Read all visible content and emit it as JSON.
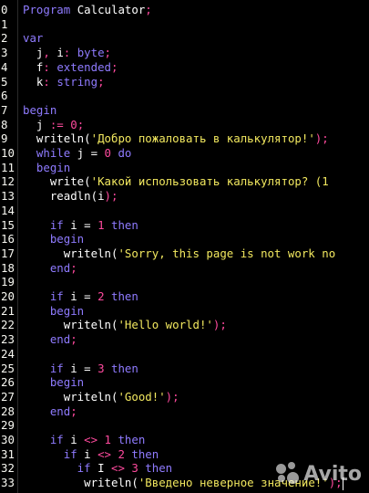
{
  "editor": {
    "lines": [
      {
        "num": "0",
        "tokens": [
          {
            "t": "Program ",
            "c": "kw"
          },
          {
            "t": "Calculator",
            "c": "txt"
          },
          {
            "t": ";",
            "c": "op"
          }
        ]
      },
      {
        "num": "1",
        "tokens": []
      },
      {
        "num": "2",
        "tokens": [
          {
            "t": "var",
            "c": "kw"
          }
        ]
      },
      {
        "num": "3",
        "tokens": [
          {
            "t": "  j",
            "c": "txt"
          },
          {
            "t": ", ",
            "c": "op"
          },
          {
            "t": "i",
            "c": "txt"
          },
          {
            "t": ": ",
            "c": "op"
          },
          {
            "t": "byte",
            "c": "ty"
          },
          {
            "t": ";",
            "c": "op"
          }
        ]
      },
      {
        "num": "4",
        "tokens": [
          {
            "t": "  f",
            "c": "txt"
          },
          {
            "t": ": ",
            "c": "op"
          },
          {
            "t": "extended",
            "c": "ty"
          },
          {
            "t": ";",
            "c": "op"
          }
        ]
      },
      {
        "num": "5",
        "tokens": [
          {
            "t": "  k",
            "c": "txt"
          },
          {
            "t": ": ",
            "c": "op"
          },
          {
            "t": "string",
            "c": "ty"
          },
          {
            "t": ";",
            "c": "op"
          }
        ]
      },
      {
        "num": "6",
        "tokens": []
      },
      {
        "num": "7",
        "tokens": [
          {
            "t": "begin",
            "c": "kw"
          }
        ]
      },
      {
        "num": "8",
        "tokens": [
          {
            "t": "  j ",
            "c": "txt"
          },
          {
            "t": ":= 0",
            "c": "op"
          },
          {
            "t": ";",
            "c": "op"
          }
        ]
      },
      {
        "num": "9",
        "tokens": [
          {
            "t": "  writeln(",
            "c": "txt"
          },
          {
            "t": "'Добро пожаловать в калькулятор!'",
            "c": "str"
          },
          {
            "t": ");",
            "c": "op"
          }
        ]
      },
      {
        "num": "10",
        "tokens": [
          {
            "t": "  while",
            "c": "kw"
          },
          {
            "t": " j = ",
            "c": "txt"
          },
          {
            "t": "0",
            "c": "op"
          },
          {
            "t": " do",
            "c": "kw"
          }
        ]
      },
      {
        "num": "11",
        "tokens": [
          {
            "t": "  begin",
            "c": "kw"
          }
        ]
      },
      {
        "num": "12",
        "tokens": [
          {
            "t": "    write(",
            "c": "txt"
          },
          {
            "t": "'Какой использовать калькулятор? (1",
            "c": "str"
          }
        ]
      },
      {
        "num": "13",
        "tokens": [
          {
            "t": "    readln(",
            "c": "txt"
          },
          {
            "t": "i",
            "c": "txt"
          },
          {
            "t": ");",
            "c": "op"
          }
        ]
      },
      {
        "num": "14",
        "tokens": []
      },
      {
        "num": "15",
        "tokens": [
          {
            "t": "    if",
            "c": "kw"
          },
          {
            "t": " i = ",
            "c": "txt"
          },
          {
            "t": "1",
            "c": "op"
          },
          {
            "t": " then",
            "c": "kw"
          }
        ]
      },
      {
        "num": "16",
        "tokens": [
          {
            "t": "    begin",
            "c": "kw"
          }
        ]
      },
      {
        "num": "17",
        "tokens": [
          {
            "t": "      writeln(",
            "c": "txt"
          },
          {
            "t": "'Sorry, this page is not work no",
            "c": "str"
          }
        ]
      },
      {
        "num": "18",
        "tokens": [
          {
            "t": "    end",
            "c": "kw"
          },
          {
            "t": ";",
            "c": "op"
          }
        ]
      },
      {
        "num": "19",
        "tokens": []
      },
      {
        "num": "20",
        "tokens": [
          {
            "t": "    if",
            "c": "kw"
          },
          {
            "t": " i = ",
            "c": "txt"
          },
          {
            "t": "2",
            "c": "op"
          },
          {
            "t": " then",
            "c": "kw"
          }
        ]
      },
      {
        "num": "21",
        "tokens": [
          {
            "t": "    begin",
            "c": "kw"
          }
        ]
      },
      {
        "num": "22",
        "tokens": [
          {
            "t": "      writeln(",
            "c": "txt"
          },
          {
            "t": "'Hello world!'",
            "c": "str"
          },
          {
            "t": ");",
            "c": "op"
          }
        ]
      },
      {
        "num": "23",
        "tokens": [
          {
            "t": "    end",
            "c": "kw"
          },
          {
            "t": ";",
            "c": "op"
          }
        ]
      },
      {
        "num": "24",
        "tokens": []
      },
      {
        "num": "25",
        "tokens": [
          {
            "t": "    if",
            "c": "kw"
          },
          {
            "t": " i = ",
            "c": "txt"
          },
          {
            "t": "3",
            "c": "op"
          },
          {
            "t": " then",
            "c": "kw"
          }
        ]
      },
      {
        "num": "26",
        "tokens": [
          {
            "t": "    begin",
            "c": "kw"
          }
        ]
      },
      {
        "num": "27",
        "tokens": [
          {
            "t": "      writeln(",
            "c": "txt"
          },
          {
            "t": "'Good!'",
            "c": "str"
          },
          {
            "t": ");",
            "c": "op"
          }
        ]
      },
      {
        "num": "28",
        "tokens": [
          {
            "t": "    end",
            "c": "kw"
          },
          {
            "t": ";",
            "c": "op"
          }
        ]
      },
      {
        "num": "29",
        "tokens": []
      },
      {
        "num": "30",
        "tokens": [
          {
            "t": "    if",
            "c": "kw"
          },
          {
            "t": " i ",
            "c": "txt"
          },
          {
            "t": "<> 1",
            "c": "op"
          },
          {
            "t": " then",
            "c": "kw"
          }
        ]
      },
      {
        "num": "31",
        "tokens": [
          {
            "t": "      if",
            "c": "kw"
          },
          {
            "t": " i ",
            "c": "txt"
          },
          {
            "t": "<> 2",
            "c": "op"
          },
          {
            "t": " then",
            "c": "kw"
          }
        ]
      },
      {
        "num": "32",
        "tokens": [
          {
            "t": "        if",
            "c": "kw"
          },
          {
            "t": " I ",
            "c": "txt"
          },
          {
            "t": "<> 3",
            "c": "op"
          },
          {
            "t": " then",
            "c": "kw"
          }
        ]
      },
      {
        "num": "33",
        "tokens": [
          {
            "t": "         writeln(",
            "c": "txt"
          },
          {
            "t": "'Введено неверное значение!'",
            "c": "str"
          },
          {
            "t": ");",
            "c": "op"
          }
        ]
      }
    ]
  },
  "watermark": {
    "text": "Avito"
  },
  "colors": {
    "background": "#000000",
    "keyword": "#8f7bff",
    "string": "#f2e85f",
    "operator": "#ff4a9e",
    "text": "#ffffff"
  }
}
